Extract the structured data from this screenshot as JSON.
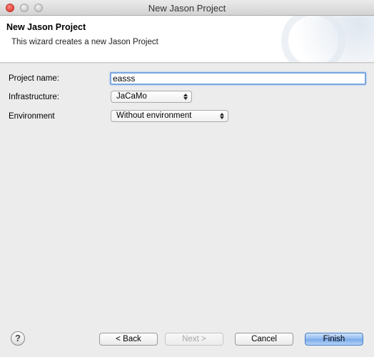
{
  "window": {
    "title": "New Jason Project"
  },
  "banner": {
    "title": "New Jason Project",
    "description": "This wizard creates a new Jason Project"
  },
  "form": {
    "project_name_label": "Project name:",
    "project_name_value": "easss",
    "infrastructure_label": "Infrastructure:",
    "infrastructure_value": "JaCaMo",
    "environment_label": "Environment",
    "environment_value": "Without environment"
  },
  "buttons": {
    "help": "?",
    "back": "< Back",
    "next": "Next >",
    "cancel": "Cancel",
    "finish": "Finish"
  },
  "colors": {
    "focus_ring": "#7aa7e0",
    "default_button": "#8cb7ee",
    "close_button": "#e0443a"
  },
  "icons": {
    "close": "close-traffic-light-icon",
    "minimize": "minimize-traffic-light-icon",
    "zoom": "zoom-traffic-light-icon",
    "help": "help-icon",
    "select_arrows": "up-down-arrows-icon"
  }
}
